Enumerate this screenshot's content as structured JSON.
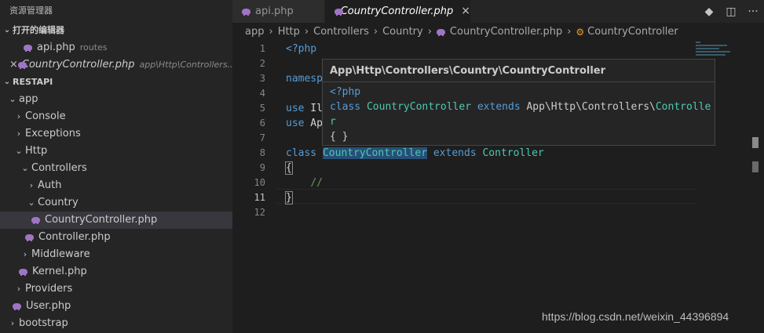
{
  "sidebar": {
    "title": "资源管理器",
    "open_editors_header": "打开的编辑器",
    "open_editors": [
      {
        "name": "api.php",
        "hint": "routes"
      },
      {
        "name": "CountryController.php",
        "hint": "app\\Http\\Controllers..."
      }
    ],
    "project_header": "RESTAPI",
    "tree": [
      {
        "label": "app"
      },
      {
        "label": "Console"
      },
      {
        "label": "Exceptions"
      },
      {
        "label": "Http"
      },
      {
        "label": "Controllers"
      },
      {
        "label": "Auth"
      },
      {
        "label": "Country"
      },
      {
        "label": "CountryController.php"
      },
      {
        "label": "Controller.php"
      },
      {
        "label": "Middleware"
      },
      {
        "label": "Kernel.php"
      },
      {
        "label": "Providers"
      },
      {
        "label": "User.php"
      },
      {
        "label": "bootstrap"
      }
    ]
  },
  "tabs": [
    {
      "label": "api.php"
    },
    {
      "label": "CountryController.php"
    }
  ],
  "breadcrumb": [
    "app",
    "Http",
    "Controllers",
    "Country",
    "CountryController.php",
    "CountryController"
  ],
  "line_numbers": [
    "1",
    "2",
    "3",
    "4",
    "5",
    "6",
    "7",
    "8",
    "9",
    "10",
    "11",
    "12"
  ],
  "code": {
    "l1": "<?php",
    "l3": "namesp",
    "l5_kw": "use",
    "l5_rest": " Il",
    "l6_kw": "use",
    "l6_rest": " Ap",
    "l8_kw": "class",
    "l8_cls": "CountryController",
    "l8_ext": "extends",
    "l8_parent": "Controller",
    "l9": "{",
    "l10": "//",
    "l11": "}"
  },
  "hover": {
    "title": "App\\Http\\Controllers\\Country\\CountryController",
    "line1": "<?php",
    "line2_kw": "class",
    "line2_cls": "CountryController",
    "line2_ext": "extends",
    "line2_ns": "App\\Http\\Controllers\\",
    "line2_parent": "Controlle",
    "line3_parent": "r",
    "line4": "{ }"
  },
  "watermark": "https://blog.csdn.net/weixin_44396894",
  "colors": {
    "keyword": "#569cd6",
    "class": "#4ec9b0",
    "comment": "#6a9955",
    "php_icon": "#a074c4"
  }
}
